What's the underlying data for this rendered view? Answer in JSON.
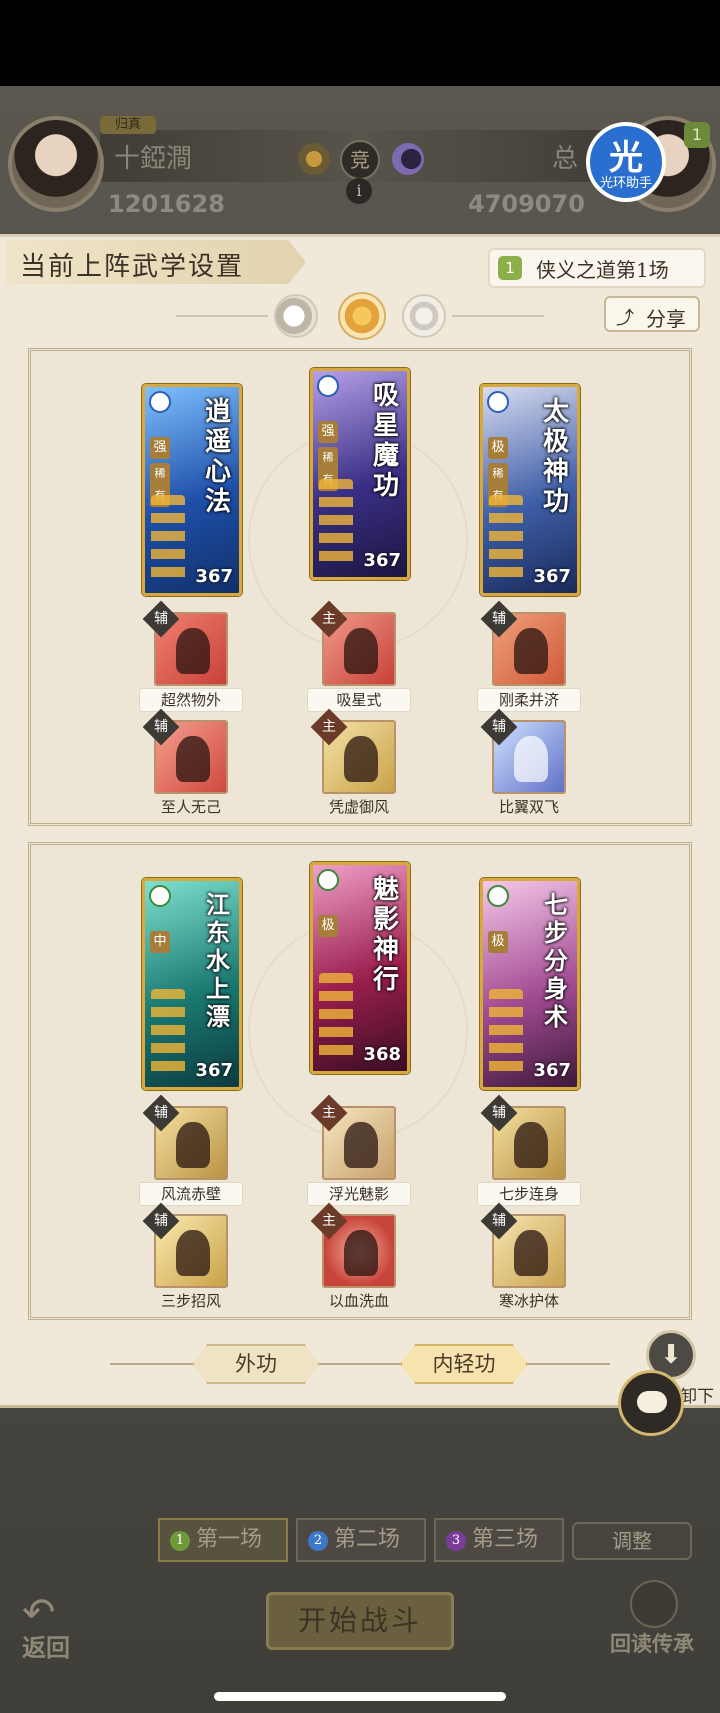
{
  "header": {
    "left_player": {
      "tag": "归真",
      "name": "十錏澗",
      "power": "1201628"
    },
    "right_player": {
      "name": "总",
      "power": "4709070",
      "level_badge": "1"
    },
    "vs_glyph": "竞",
    "info_glyph": "i",
    "helper": {
      "glyph": "光",
      "label": "光环助手"
    }
  },
  "panel": {
    "title": "当前上阵武学设置",
    "stage": {
      "num": "1",
      "label": "侠义之道第1场"
    },
    "share_label": "分享",
    "share_icon": "share-icon"
  },
  "group1": {
    "cards": [
      {
        "name": "逍遥心法",
        "rank": "强",
        "rarity": "稀有",
        "level": "367",
        "art": "#2d6fd0"
      },
      {
        "name": "吸星魔功",
        "rank": "强",
        "rarity": "稀有",
        "level": "367",
        "art": "#3b3a8a"
      },
      {
        "name": "太极神功",
        "rank": "极",
        "rarity": "稀有",
        "level": "367",
        "art": "#2b4f9a"
      }
    ],
    "row1": [
      {
        "badge": "辅",
        "label": "超然物外",
        "color": "#d9574a"
      },
      {
        "badge": "主",
        "label": "吸星式",
        "color": "#c85d52"
      },
      {
        "badge": "辅",
        "label": "刚柔并济",
        "color": "#d66a4a"
      }
    ],
    "row2": [
      {
        "badge": "辅",
        "label": "至人无己",
        "color": "#d96050"
      },
      {
        "badge": "主",
        "label": "凭虚御风",
        "color": "#d8b562"
      },
      {
        "badge": "辅",
        "label": "比翼双飞",
        "color": "#6a7fd0"
      }
    ]
  },
  "group2": {
    "cards": [
      {
        "name": "江东水上漂",
        "rank": "中",
        "rarity": "",
        "level": "367",
        "art": "#1f8a7e"
      },
      {
        "name": "魅影神行",
        "rank": "极",
        "rarity": "",
        "level": "368",
        "art": "#a02a5a"
      },
      {
        "name": "七步分身术",
        "rank": "极",
        "rarity": "",
        "level": "367",
        "art": "#b45aa0"
      }
    ],
    "row1": [
      {
        "badge": "辅",
        "label": "风流赤壁",
        "color": "#d9b45c"
      },
      {
        "badge": "主",
        "label": "浮光魅影",
        "color": "#d9b87a"
      },
      {
        "badge": "辅",
        "label": "七步连身",
        "color": "#d6b45a"
      }
    ],
    "row2": [
      {
        "badge": "辅",
        "label": "三步招风",
        "color": "#e0b85a"
      },
      {
        "badge": "主",
        "label": "以血洗血",
        "color": "#d0605a"
      },
      {
        "badge": "辅",
        "label": "寒冰护体",
        "color": "#d8b46a"
      }
    ]
  },
  "tabs": {
    "outer": "外功",
    "inner": "内轻功"
  },
  "download_label": "卸下",
  "battles": [
    {
      "num": "1",
      "label": "第一场",
      "color": "#6f9a3a"
    },
    {
      "num": "2",
      "label": "第二场",
      "color": "#3c77c8"
    },
    {
      "num": "3",
      "label": "第三场",
      "color": "#7a3c9a"
    }
  ],
  "adjust_label": "调整",
  "start_label": "开始战斗",
  "back_label": "返回",
  "recall_label": "回读传承"
}
